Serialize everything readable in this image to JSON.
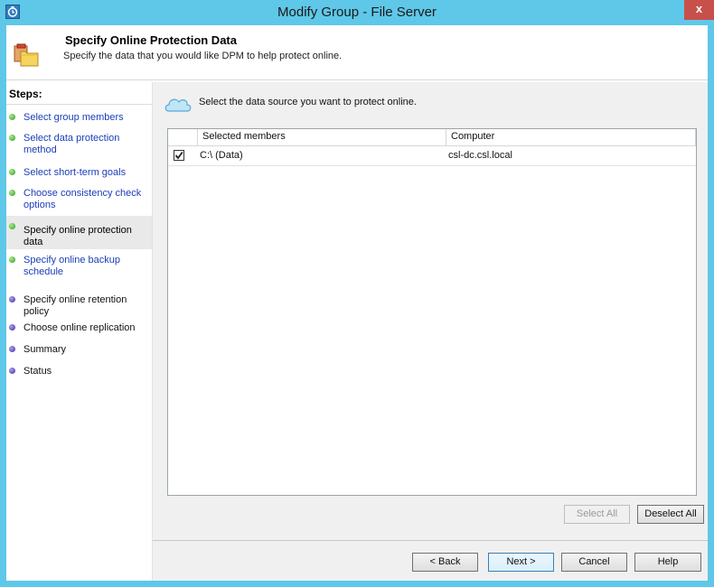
{
  "window": {
    "title": "Modify Group - File Server",
    "close_label": "x",
    "accent_color": "#5fc7e8"
  },
  "header": {
    "title": "Specify Online Protection Data",
    "description": "Specify the data that you would like DPM to help protect online.",
    "icon": "folder-group-icon"
  },
  "steps": {
    "title": "Steps:",
    "items": [
      {
        "label": "Select group members",
        "status": "done"
      },
      {
        "label": "Select data protection method",
        "status": "done"
      },
      {
        "label": "Select short-term goals",
        "status": "done"
      },
      {
        "label": "Choose consistency check options",
        "status": "done"
      },
      {
        "label": "Specify online protection data",
        "status": "current"
      },
      {
        "label": "Specify online backup schedule",
        "status": "done"
      },
      {
        "label": "Specify online retention policy",
        "status": "pending"
      },
      {
        "label": "Choose online replication",
        "status": "pending"
      },
      {
        "label": "Summary",
        "status": "pending"
      },
      {
        "label": "Status",
        "status": "pending"
      }
    ]
  },
  "main": {
    "instruction": "Select the data source you want to protect online.",
    "table": {
      "columns": [
        "Selected members",
        "Computer"
      ],
      "rows": [
        {
          "checked": true,
          "member": "C:\\ (Data)",
          "computer": "csl-dc.csl.local"
        }
      ]
    },
    "select_all_label": "Select All",
    "deselect_all_label": "Deselect All"
  },
  "footer": {
    "back_label": "< Back",
    "next_label": "Next >",
    "cancel_label": "Cancel",
    "help_label": "Help"
  }
}
